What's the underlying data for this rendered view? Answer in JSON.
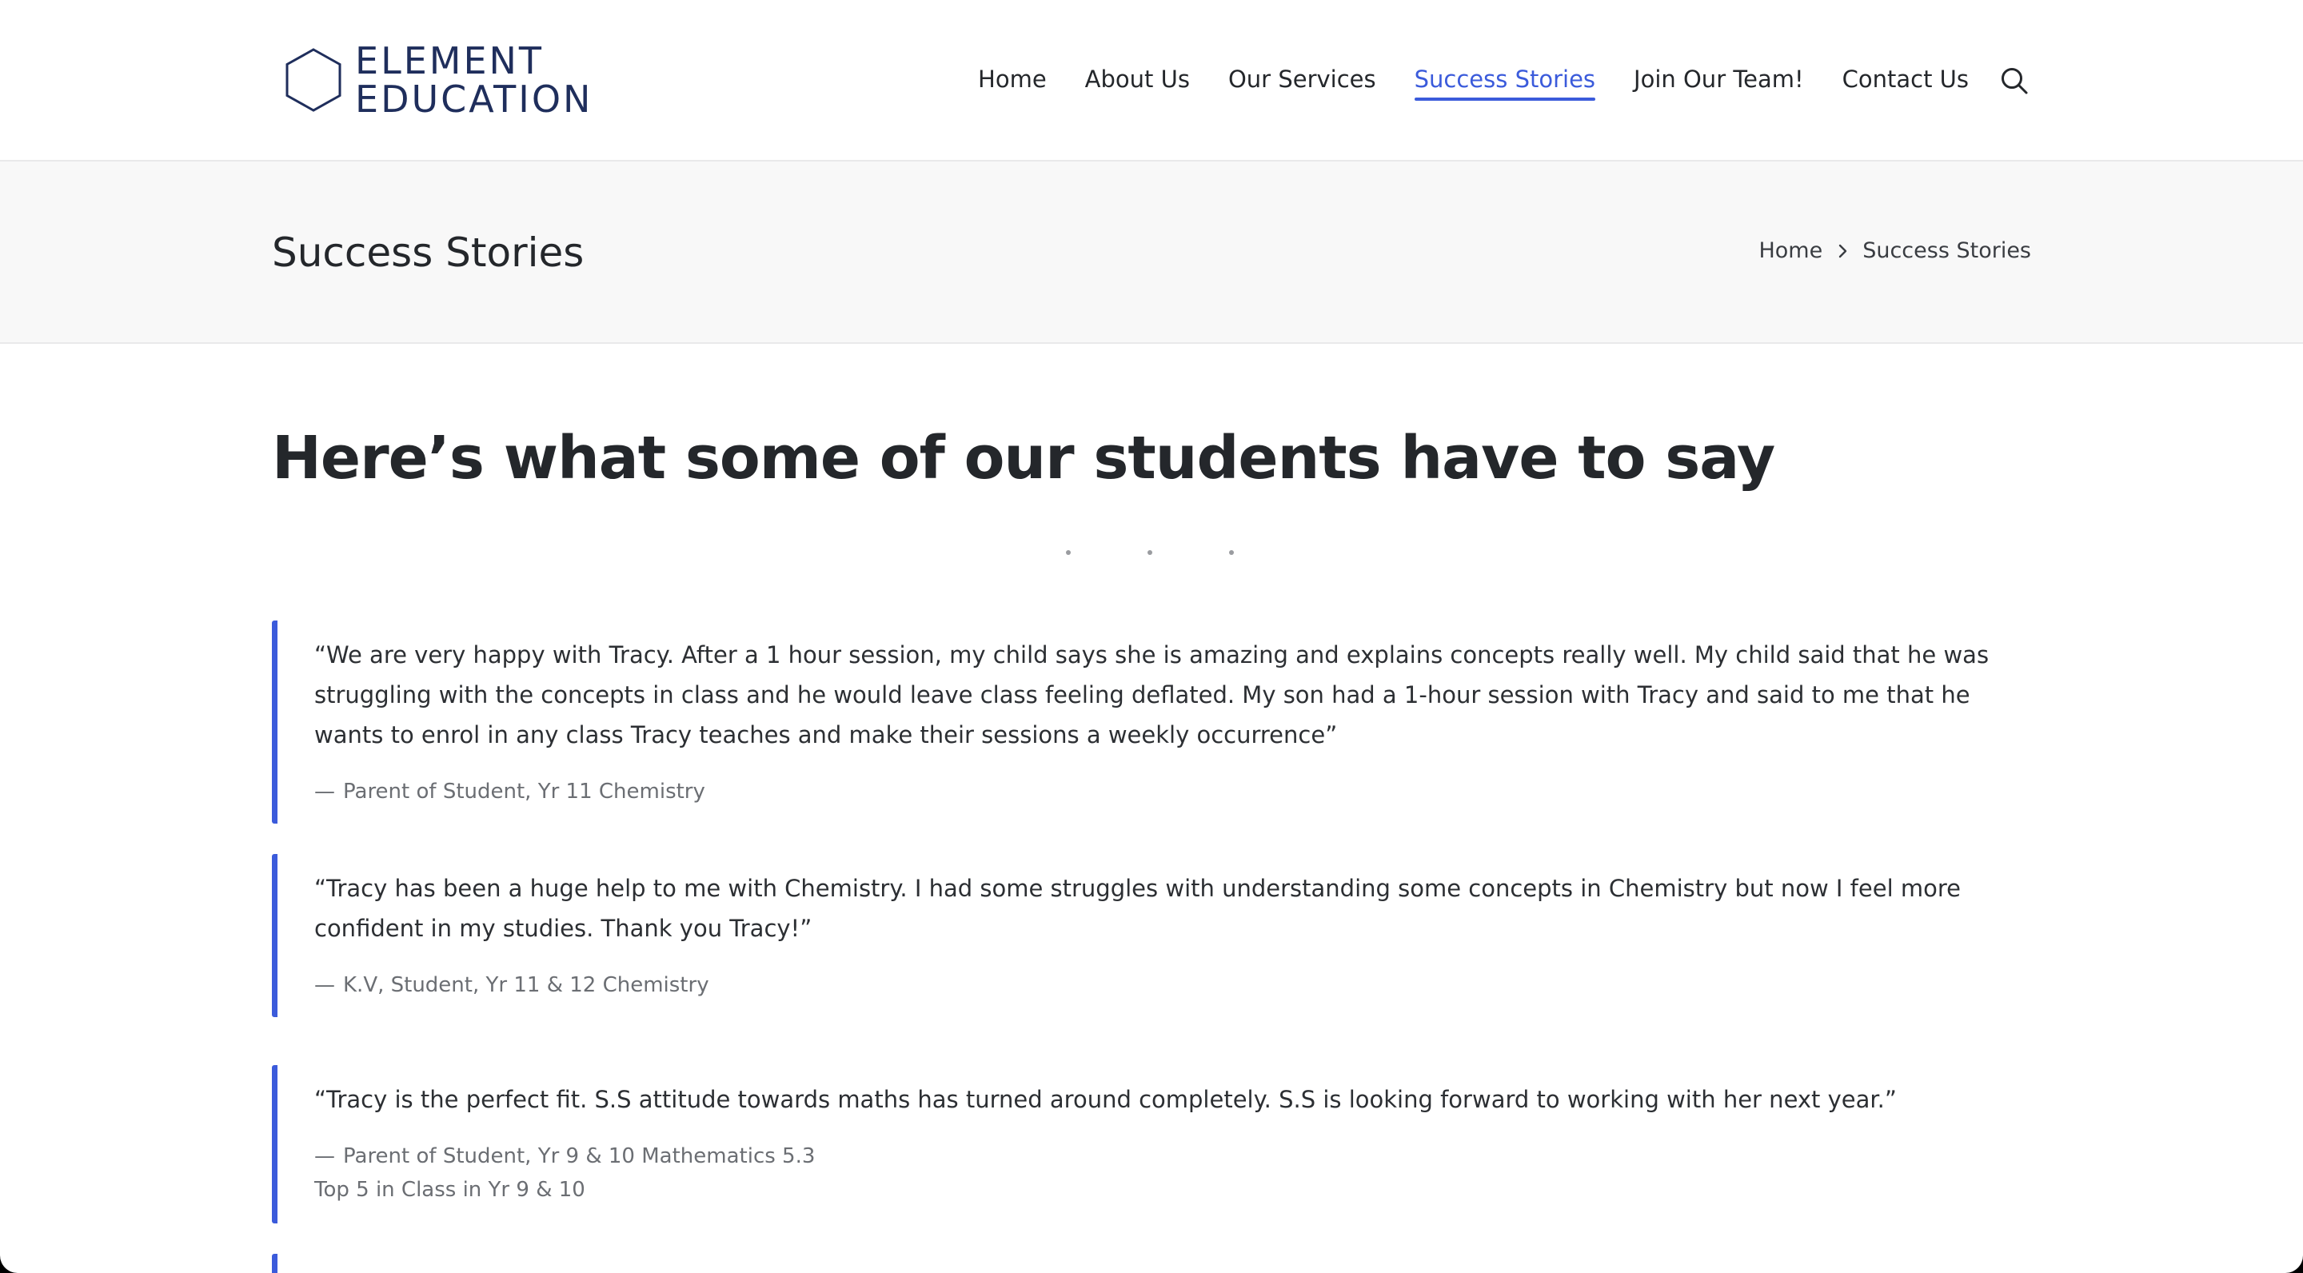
{
  "header": {
    "logo": {
      "line1": "ELEMENT",
      "line2": "EDUCATION"
    },
    "nav": [
      {
        "label": "Home",
        "active": false
      },
      {
        "label": "About Us",
        "active": false
      },
      {
        "label": "Our Services",
        "active": false
      },
      {
        "label": "Success Stories",
        "active": true
      },
      {
        "label": "Join Our Team!",
        "active": false
      },
      {
        "label": "Contact Us",
        "active": false
      }
    ],
    "search_icon": "search-icon"
  },
  "title_bar": {
    "title": "Success Stories",
    "breadcrumb": {
      "home": "Home",
      "current": "Success Stories"
    }
  },
  "content": {
    "heading": "Here’s what some of our students have to say",
    "quotes": [
      {
        "text": "“We are very happy with Tracy. After a 1 hour session, my child says she is amazing and explains concepts really well. My child said that he was struggling with the concepts in class and he would leave class feeling deflated. My son had a 1-hour session with Tracy and said to me that he wants to enrol in any class Tracy teaches and make their sessions a weekly occurrence”",
        "cite": "Parent of Student, Yr 11 Chemistry"
      },
      {
        "text": "“Tracy has been a huge help to me with Chemistry. I had some struggles with understanding some concepts in Chemistry but now I feel more confident in my studies. Thank you Tracy!”",
        "cite": "K.V, Student, Yr 11 & 12 Chemistry"
      },
      {
        "text": "“Tracy is the perfect fit.  S.S attitude towards maths has turned around completely.  S.S is looking forward to working with her next year.”",
        "cite": "Parent of Student, Yr 9 & 10 Mathematics 5.3",
        "extra": "Top 5 in Class in Yr 9 & 10"
      }
    ],
    "cite_dash": "—"
  },
  "colors": {
    "accent": "#3b5bdb",
    "brand_navy": "#1f2e5c",
    "text": "#24272b",
    "muted": "#6b6e73",
    "title_bar_bg": "#f8f8f8"
  }
}
